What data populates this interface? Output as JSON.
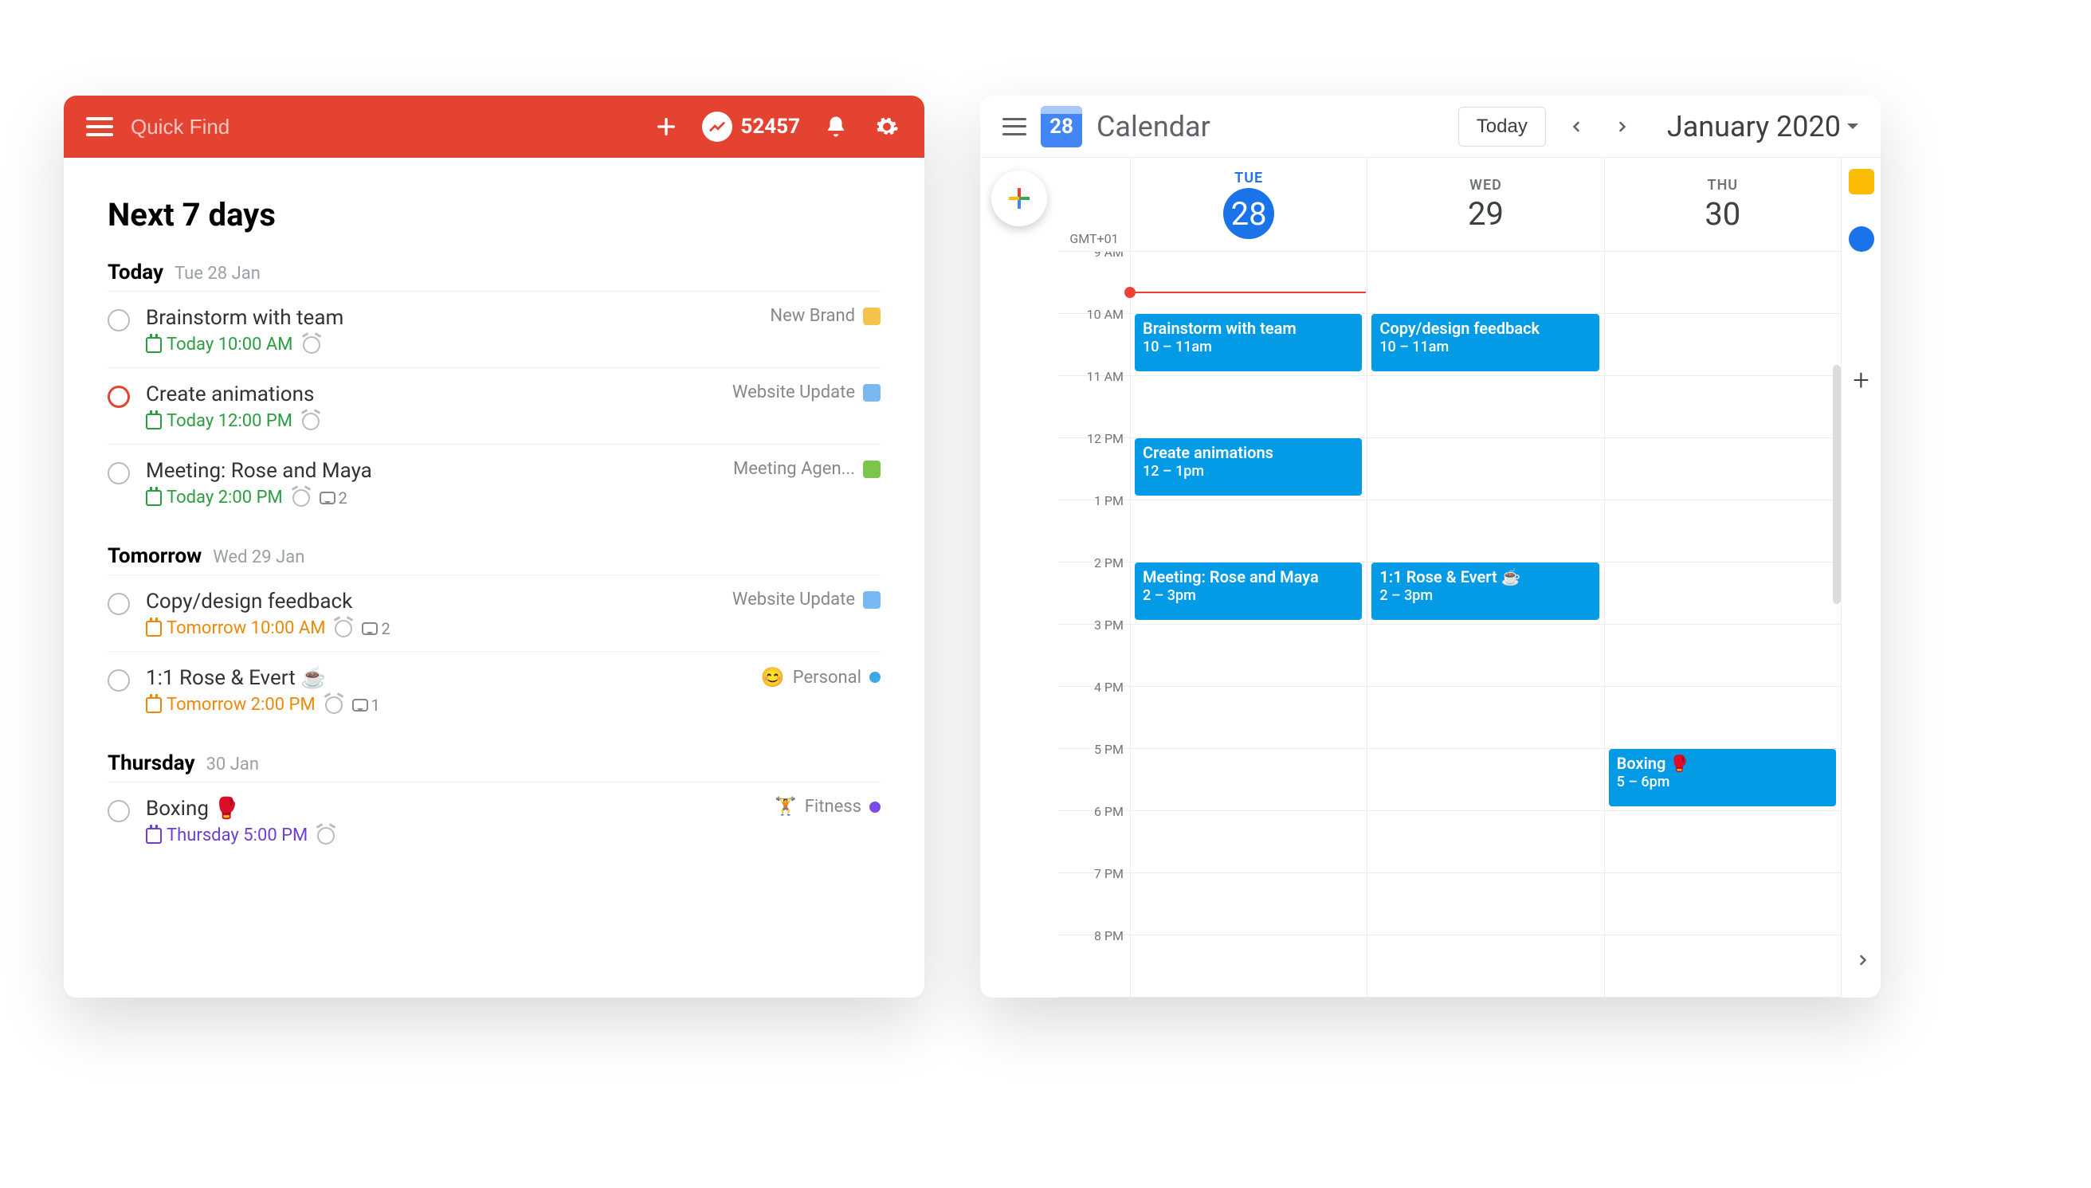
{
  "todo": {
    "search_placeholder": "Quick Find",
    "karma": "52457",
    "title": "Next 7 days",
    "sections": [
      {
        "name": "Today",
        "sub": "Tue 28 Jan"
      },
      {
        "name": "Tomorrow",
        "sub": "Wed 29 Jan"
      },
      {
        "name": "Thursday",
        "sub": "30 Jan"
      }
    ],
    "tasks": {
      "t1": {
        "title": "Brainstorm with team",
        "date": "Today 10:00 AM",
        "project": "New Brand"
      },
      "t2": {
        "title": "Create animations",
        "date": "Today 12:00 PM",
        "project": "Website Update"
      },
      "t3": {
        "title": "Meeting: Rose and Maya",
        "date": "Today 2:00 PM",
        "comments": "2",
        "project": "Meeting Agen..."
      },
      "t4": {
        "title": "Copy/design feedback",
        "date": "Tomorrow 10:00 AM",
        "comments": "2",
        "project": "Website Update"
      },
      "t5": {
        "title": "1:1 Rose & Evert ☕",
        "date": "Tomorrow 2:00 PM",
        "comments": "1",
        "project": "Personal"
      },
      "t6": {
        "title": "Boxing 🥊",
        "date": "Thursday 5:00 PM",
        "project": "Fitness"
      }
    }
  },
  "gcal": {
    "logo_day": "28",
    "title": "Calendar",
    "today_btn": "Today",
    "month": "January 2020",
    "timezone": "GMT+01",
    "days": [
      {
        "dow": "TUE",
        "num": "28",
        "active": true
      },
      {
        "dow": "WED",
        "num": "29",
        "active": false
      },
      {
        "dow": "THU",
        "num": "30",
        "active": false
      }
    ],
    "hours": [
      "9 AM",
      "10 AM",
      "11 AM",
      "12 PM",
      "1 PM",
      "2 PM",
      "3 PM",
      "4 PM",
      "5 PM",
      "6 PM",
      "7 PM",
      "8 PM"
    ],
    "events": {
      "e1": {
        "title": "Brainstorm with team",
        "time": "10 – 11am"
      },
      "e2": {
        "title": "Create animations",
        "time": "12 – 1pm"
      },
      "e3": {
        "title": "Meeting: Rose and Maya",
        "time": "2 – 3pm"
      },
      "e4": {
        "title": "Copy/design feedback",
        "time": "10 – 11am"
      },
      "e5": {
        "title": "1:1 Rose & Evert ☕",
        "time": "2 – 3pm"
      },
      "e6": {
        "title": "Boxing 🥊",
        "time": "5 – 6pm"
      }
    }
  }
}
